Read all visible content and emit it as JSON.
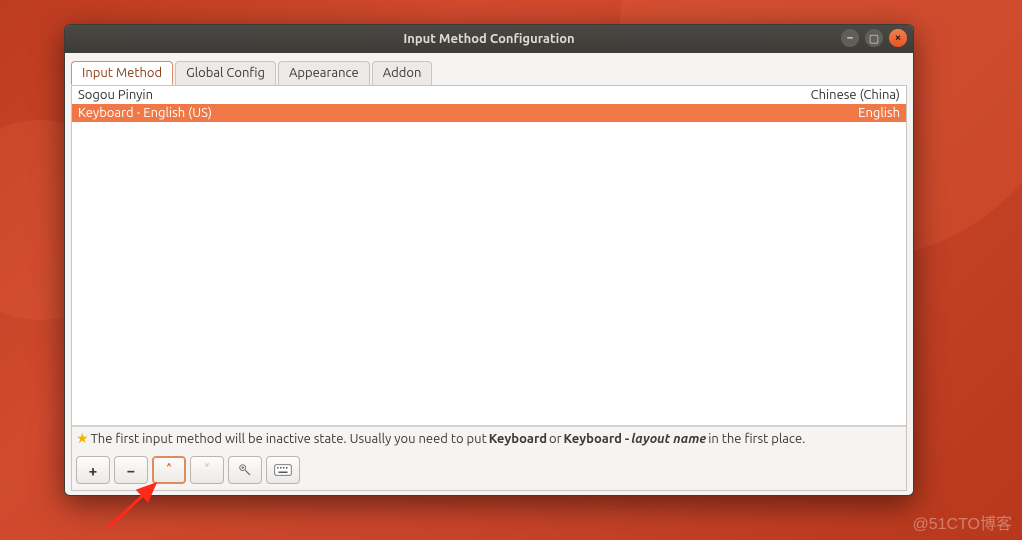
{
  "titlebar": {
    "title": "Input Method Configuration"
  },
  "tabs": [
    {
      "label": "Input Method",
      "active": true
    },
    {
      "label": "Global Config",
      "active": false
    },
    {
      "label": "Appearance",
      "active": false
    },
    {
      "label": "Addon",
      "active": false
    }
  ],
  "list": [
    {
      "name": "Sogou Pinyin",
      "lang": "Chinese (China)",
      "selected": false
    },
    {
      "name": "Keyboard - English (US)",
      "lang": "English",
      "selected": true
    }
  ],
  "hint": {
    "prefix": "The first input method will be inactive state. Usually you need to put ",
    "kw1": "Keyboard",
    "or": " or ",
    "kw2_bold": "Keyboard - ",
    "kw2_italic": "layout name",
    "suffix": " in the first place."
  },
  "toolbar": {
    "add": "+",
    "remove": "−",
    "up": "˄",
    "down": "˅"
  },
  "watermark": "@51CTO博客"
}
